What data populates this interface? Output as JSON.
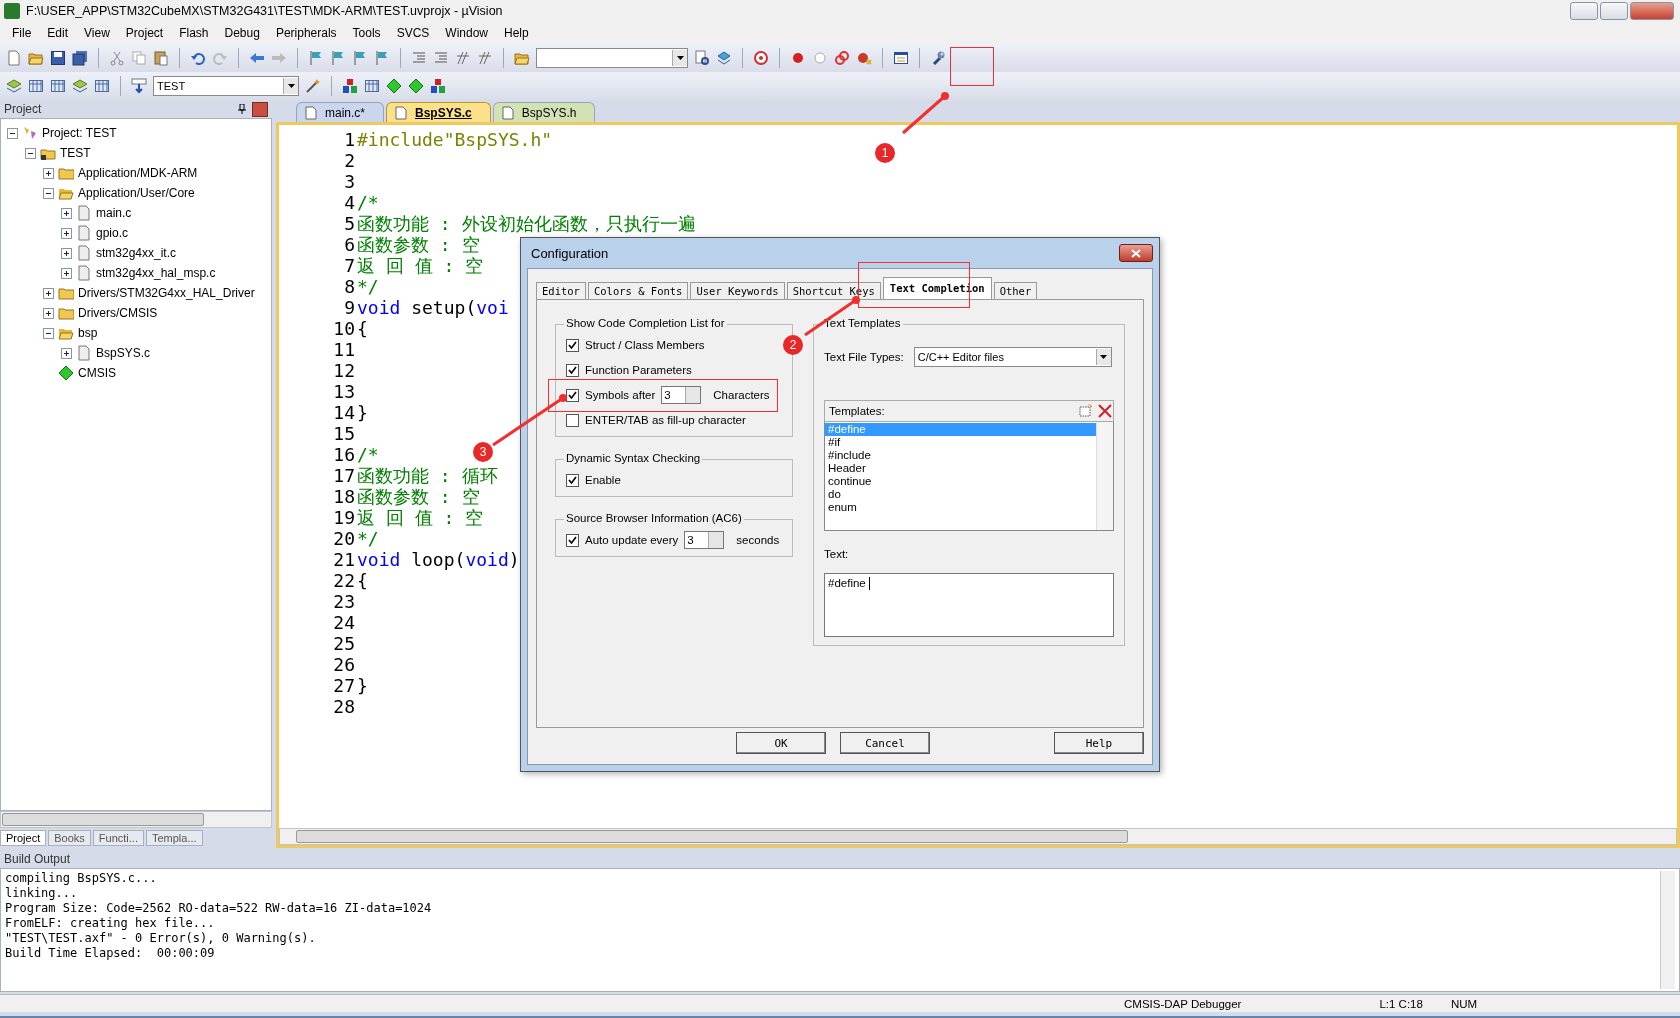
{
  "window": {
    "title": "F:\\USER_APP\\STM32CubeMX\\STM32G431\\TEST\\MDK-ARM\\TEST.uvprojx - µVision"
  },
  "menu": [
    "File",
    "Edit",
    "View",
    "Project",
    "Flash",
    "Debug",
    "Peripherals",
    "Tools",
    "SVCS",
    "Window",
    "Help"
  ],
  "toolbar": {
    "target": "TEST"
  },
  "project_panel": {
    "title": "Project",
    "tree": [
      {
        "kind": "project",
        "label": "Project: TEST",
        "expanded": true,
        "children": [
          {
            "kind": "target",
            "label": "TEST",
            "expanded": true,
            "children": [
              {
                "kind": "folder",
                "label": "Application/MDK-ARM",
                "expanded": false
              },
              {
                "kind": "folder",
                "label": "Application/User/Core",
                "expanded": true,
                "children": [
                  {
                    "kind": "file",
                    "label": "main.c",
                    "expanded": false
                  },
                  {
                    "kind": "file",
                    "label": "gpio.c",
                    "expanded": false
                  },
                  {
                    "kind": "file",
                    "label": "stm32g4xx_it.c",
                    "expanded": false
                  },
                  {
                    "kind": "file",
                    "label": "stm32g4xx_hal_msp.c",
                    "expanded": false
                  }
                ]
              },
              {
                "kind": "folder",
                "label": "Drivers/STM32G4xx_HAL_Driver",
                "expanded": false
              },
              {
                "kind": "folder",
                "label": "Drivers/CMSIS",
                "expanded": false
              },
              {
                "kind": "folder",
                "label": "bsp",
                "expanded": true,
                "children": [
                  {
                    "kind": "file",
                    "label": "BspSYS.c",
                    "expanded": false
                  }
                ]
              },
              {
                "kind": "component",
                "label": "CMSIS"
              }
            ]
          }
        ]
      }
    ],
    "tabs": [
      {
        "label": "Project",
        "selected": true
      },
      {
        "label": "Books",
        "selected": false
      },
      {
        "label": "Functi...",
        "selected": false
      },
      {
        "label": "Templa...",
        "selected": false
      }
    ]
  },
  "editor": {
    "tabs": [
      {
        "label": "main.c*",
        "selected": false,
        "color": "#c9d6ee"
      },
      {
        "label": "BspSYS.c",
        "selected": true,
        "color": "#fbe28a"
      },
      {
        "label": "BspSYS.h",
        "selected": false,
        "color": "#d3e2b4"
      }
    ],
    "lines": [
      {
        "number": "1",
        "segments": [
          {
            "kind": "preprocessor",
            "text": "#include\"BspSYS.h\""
          }
        ]
      },
      {
        "number": "2"
      },
      {
        "number": "3"
      },
      {
        "number": "4",
        "segments": [
          {
            "kind": "comment",
            "text": "/*"
          }
        ]
      },
      {
        "number": "5",
        "segments": [
          {
            "kind": "comment",
            "text": "函数功能 : 外设初始化函数，只执行一遍"
          }
        ]
      },
      {
        "number": "6",
        "segments": [
          {
            "kind": "comment",
            "text": "函数参数 : 空"
          }
        ]
      },
      {
        "number": "7",
        "segments": [
          {
            "kind": "comment",
            "text": "返 回 值 : 空"
          }
        ]
      },
      {
        "number": "8",
        "segments": [
          {
            "kind": "comment",
            "text": "*/"
          }
        ]
      },
      {
        "number": "9",
        "segments": [
          {
            "kind": "keyword",
            "text": "void"
          },
          {
            "kind": "plain",
            "text": " setup("
          },
          {
            "kind": "keyword",
            "text": "voi"
          }
        ]
      },
      {
        "number": "10",
        "segments": [
          {
            "kind": "plain",
            "text": "{"
          }
        ]
      },
      {
        "number": "11"
      },
      {
        "number": "12"
      },
      {
        "number": "13"
      },
      {
        "number": "14",
        "segments": [
          {
            "kind": "plain",
            "text": "}"
          }
        ]
      },
      {
        "number": "15"
      },
      {
        "number": "16",
        "segments": [
          {
            "kind": "comment",
            "text": "/*"
          }
        ]
      },
      {
        "number": "17",
        "segments": [
          {
            "kind": "comment",
            "text": "函数功能 : 循环"
          }
        ]
      },
      {
        "number": "18",
        "segments": [
          {
            "kind": "comment",
            "text": "函数参数 : 空"
          }
        ]
      },
      {
        "number": "19",
        "segments": [
          {
            "kind": "comment",
            "text": "返 回 值 : 空"
          }
        ]
      },
      {
        "number": "20",
        "segments": [
          {
            "kind": "comment",
            "text": "*/"
          }
        ]
      },
      {
        "number": "21",
        "segments": [
          {
            "kind": "keyword",
            "text": "void"
          },
          {
            "kind": "plain",
            "text": " loop("
          },
          {
            "kind": "keyword",
            "text": "void"
          },
          {
            "kind": "plain",
            "text": ")"
          }
        ]
      },
      {
        "number": "22",
        "segments": [
          {
            "kind": "plain",
            "text": "{"
          }
        ]
      },
      {
        "number": "23"
      },
      {
        "number": "24"
      },
      {
        "number": "25"
      },
      {
        "number": "26"
      },
      {
        "number": "27",
        "segments": [
          {
            "kind": "plain",
            "text": "}"
          }
        ]
      },
      {
        "number": "28"
      }
    ]
  },
  "build_output": {
    "title": "Build Output",
    "lines": [
      "compiling BspSYS.c...",
      "linking...",
      "Program Size: Code=2562 RO-data=522 RW-data=16 ZI-data=1024",
      "FromELF: creating hex file...",
      "\"TEST\\TEST.axf\" - 0 Error(s), 0 Warning(s).",
      "Build Time Elapsed:  00:00:09"
    ]
  },
  "status_bar": [
    "CMSIS-DAP Debugger",
    "L:1 C:18",
    "NUM"
  ],
  "dialog": {
    "title": "Configuration",
    "tabs": [
      {
        "label": "Editor",
        "selected": false
      },
      {
        "label": "Colors & Fonts",
        "selected": false
      },
      {
        "label": "User Keywords",
        "selected": false
      },
      {
        "label": "Shortcut Keys",
        "selected": false
      },
      {
        "label": "Text Completion",
        "selected": true
      },
      {
        "label": "Other",
        "selected": false
      }
    ],
    "groups": [
      {
        "title": "Show Code Completion List for",
        "items": [
          {
            "kind": "checkbox",
            "label": "Struct / Class Members",
            "checked": true
          },
          {
            "kind": "checkbox",
            "label": "Function Parameters",
            "checked": true
          },
          {
            "kind": "spin",
            "label": "Symbols after",
            "value": "3",
            "suffix": "Characters",
            "checked": true
          },
          {
            "kind": "checkbox",
            "label": "ENTER/TAB as fill-up character",
            "checked": false
          }
        ]
      },
      {
        "title": "Dynamic Syntax Checking",
        "items": [
          {
            "kind": "checkbox",
            "label": "Enable",
            "checked": true
          }
        ]
      },
      {
        "title": "Source Browser Information (AC6)",
        "items": [
          {
            "kind": "spin",
            "label": "Auto update every",
            "value": "3",
            "suffix": "seconds",
            "checked": true
          }
        ]
      }
    ],
    "templates_group": {
      "title": "Text Templates",
      "file_types_label": "Text File Types:",
      "file_types_value": "C/C++ Editor files",
      "templates_label": "Templates:",
      "templates": [
        {
          "label": "#define",
          "selected": true
        },
        {
          "label": "#if",
          "selected": false
        },
        {
          "label": "#include",
          "selected": false
        },
        {
          "label": "Header",
          "selected": false
        },
        {
          "label": "continue",
          "selected": false
        },
        {
          "label": "do",
          "selected": false
        },
        {
          "label": "enum",
          "selected": false
        }
      ],
      "text_label": "Text:",
      "text_value": "#define "
    },
    "buttons": [
      "OK",
      "Cancel",
      "Help"
    ]
  },
  "annotations": [
    {
      "number": "1"
    },
    {
      "number": "2"
    },
    {
      "number": "3"
    }
  ]
}
